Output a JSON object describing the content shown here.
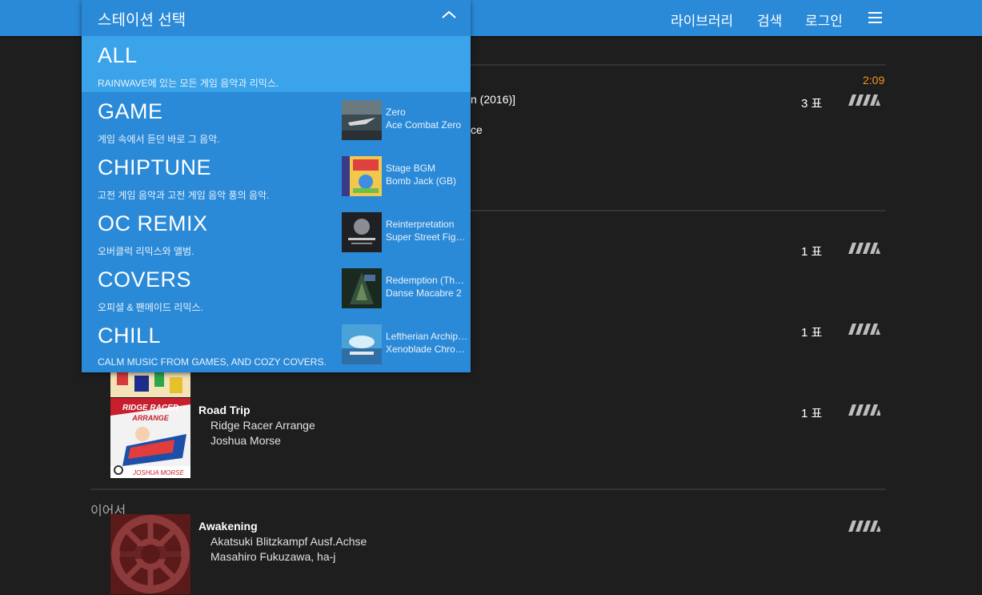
{
  "nav": {
    "library": "라이브러리",
    "search": "검색",
    "login": "로그인",
    "menu_icon": "hamburger-menu-icon"
  },
  "station_dropdown": {
    "label": "스테이션 선택",
    "chevron_icon": "chevron-up-icon",
    "stations": [
      {
        "name": "ALL",
        "desc": "RAINWAVE에 있는 모든 게임 음악과 리믹스.",
        "selected": true
      },
      {
        "name": "GAME",
        "desc": "게임 속에서 듣던 바로 그 음악.",
        "np_title": "Zero",
        "np_album": "Ace Combat Zero"
      },
      {
        "name": "CHIPTUNE",
        "desc": "고전 게임 음악과 고전 게임 음악 풍의 음악.",
        "np_title": "Stage BGM",
        "np_album": "Bomb Jack (GB)"
      },
      {
        "name": "OC REMIX",
        "desc": "오버클럭 리믹스와 앨범.",
        "np_title": "Reinterpretation",
        "np_album": "Super Street Fighter II Turbo HD Remix"
      },
      {
        "name": "COVERS",
        "desc": "오피셜 & 팬메이드 리믹스.",
        "np_title": "Redemption (The Dance of Death)",
        "np_album": "Danse Macabre 2"
      },
      {
        "name": "CHILL",
        "desc": "CALM MUSIC FROM GAMES, AND COZY COVERS.",
        "np_title": "Leftherian Archipelago",
        "np_album": "Xenoblade Chronicles X"
      }
    ]
  },
  "now_playing": {
    "time": "2:09",
    "partial_title": "n (2016)]",
    "partial_artist": "ce",
    "votes": "3 표",
    "progress": 0.34
  },
  "upcoming": [
    {
      "votes": "1 표"
    },
    {
      "votes": "1 표"
    },
    {
      "title": "Road Trip",
      "album": "Ridge Racer Arrange",
      "artist": "Joshua Morse",
      "votes": "1 표"
    }
  ],
  "history": {
    "label": "이어서",
    "items": [
      {
        "title": "Awakening",
        "album": "Akatsuki Blitzkampf Ausf.Achse",
        "artist": "Masahiro Fukuzawa, ha-j"
      }
    ]
  },
  "colors": {
    "accent_blue": "#2b8ad8",
    "selected_blue": "#3aa3ea",
    "accent_orange": "#f7941d",
    "background": "#1e1e1e"
  }
}
